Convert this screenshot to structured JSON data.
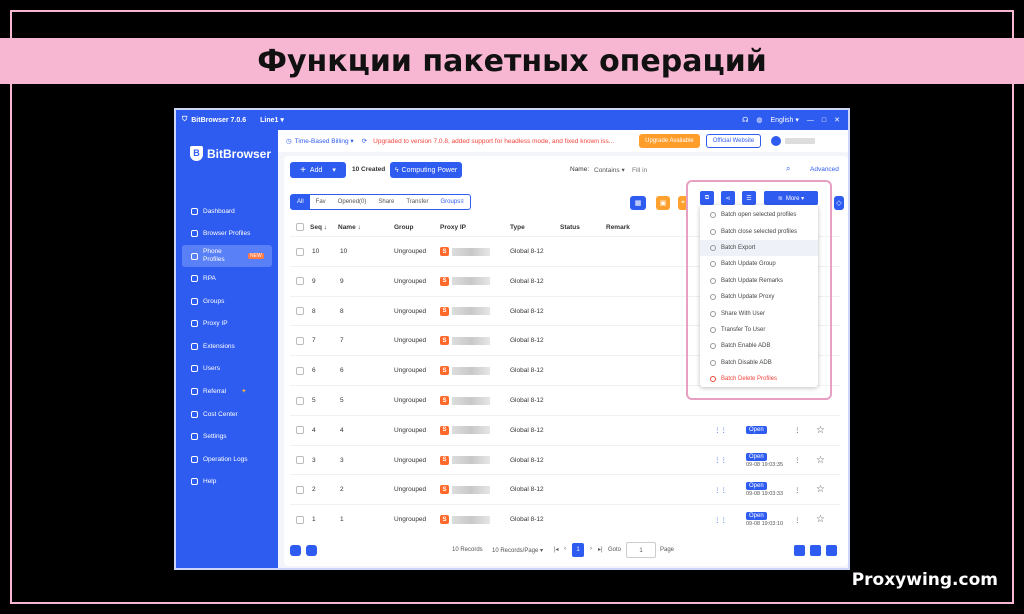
{
  "banner": {
    "title": "Функции пакетных операций"
  },
  "watermark": "Proxywing.com",
  "titlebar": {
    "app": "BitBrowser 7.0.6",
    "line": "Line1 ▾",
    "lang": "English ▾"
  },
  "sidebar": {
    "brand": "BitBrowser",
    "items": [
      {
        "label": "Dashboard"
      },
      {
        "label": "Browser Profiles"
      },
      {
        "label": "Phone Profiles",
        "tag": "NEW"
      },
      {
        "label": "RPA"
      },
      {
        "label": "Groups"
      },
      {
        "label": "Proxy IP"
      },
      {
        "label": "Extensions"
      },
      {
        "label": "Users"
      },
      {
        "label": "Referral"
      },
      {
        "label": "Cost Center"
      },
      {
        "label": "Settings"
      },
      {
        "label": "Operation Logs"
      },
      {
        "label": "Help"
      }
    ]
  },
  "topbar": {
    "billing": "Time-Based Billing ▾",
    "notice": "Upgraded to version 7.0.8, added support for headless mode, and fixed known iss...",
    "upgrade": "Upgrade Available",
    "website": "Official Website"
  },
  "toolbar": {
    "add": "Add",
    "created": "10 Created",
    "computing": "Computing Power",
    "name_label": "Name:",
    "contains": "Contains ▾",
    "fill_placeholder": "Fill in",
    "advanced": "Advanced"
  },
  "tabs": [
    "All",
    "Fav",
    "Opened(0)",
    "Share",
    "Transfer",
    "Groups"
  ],
  "table": {
    "headers": {
      "seq": "Seq ↓",
      "name": "Name ↓",
      "group": "Group",
      "proxy": "Proxy IP",
      "type": "Type",
      "status": "Status",
      "remark": "Remark"
    },
    "rows": [
      {
        "seq": "10",
        "name": "10",
        "group": "Ungrouped",
        "type": "Global 8-12"
      },
      {
        "seq": "9",
        "name": "9",
        "group": "Ungrouped",
        "type": "Global 8-12"
      },
      {
        "seq": "8",
        "name": "8",
        "group": "Ungrouped",
        "type": "Global 8-12"
      },
      {
        "seq": "7",
        "name": "7",
        "group": "Ungrouped",
        "type": "Global 8-12"
      },
      {
        "seq": "6",
        "name": "6",
        "group": "Ungrouped",
        "type": "Global 8-12"
      },
      {
        "seq": "5",
        "name": "5",
        "group": "Ungrouped",
        "type": "Global 8-12"
      },
      {
        "seq": "4",
        "name": "4",
        "group": "Ungrouped",
        "type": "Global 8-12",
        "open": "Open",
        "date": ""
      },
      {
        "seq": "3",
        "name": "3",
        "group": "Ungrouped",
        "type": "Global 8-12",
        "open": "Open",
        "date": "09-08 19:03:35"
      },
      {
        "seq": "2",
        "name": "2",
        "group": "Ungrouped",
        "type": "Global 8-12",
        "open": "Open",
        "date": "09-08 19:03:33"
      },
      {
        "seq": "1",
        "name": "1",
        "group": "Ungrouped",
        "type": "Global 8-12",
        "open": "Open",
        "date": "09-08 19:03:10"
      }
    ]
  },
  "more_button": "More ▾",
  "dropdown": [
    "Batch open selected profiles",
    "Batch close selected profiles",
    "Batch Export",
    "Batch Update Group",
    "Batch Update Remarks",
    "Batch Update Proxy",
    "Share With User",
    "Transfer To User",
    "Batch Enable ADB",
    "Batch Disable ADB",
    "Batch Delete Profiles"
  ],
  "pagination": {
    "records": "10 Records",
    "per_page": "10 Records/Page ▾",
    "current": "1",
    "goto": "Goto",
    "goto_value": "1",
    "page": "Page"
  }
}
